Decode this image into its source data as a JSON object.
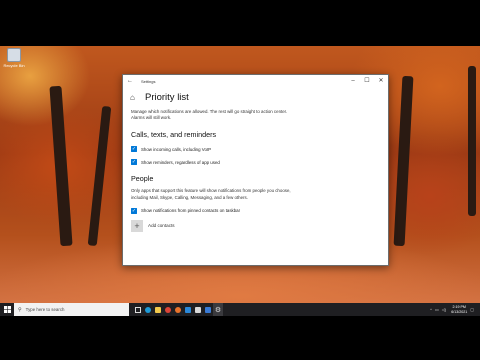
{
  "desktop": {
    "icon_label": "Recycle Bin"
  },
  "window": {
    "app_title": "Settings",
    "page_title": "Priority list",
    "description": "Manage which notifications are allowed. The rest will go straight to action center. Alarms will still work.",
    "sections": {
      "calls": {
        "title": "Calls, texts, and reminders",
        "items": [
          {
            "label": "Show incoming calls, including VoIP",
            "checked": true
          },
          {
            "label": "Show reminders, regardless of app used",
            "checked": true
          }
        ]
      },
      "people": {
        "title": "People",
        "description": "Only apps that support this feature will show notifications from people you choose, including Mail, Skype, Calling, Messaging, and a few others.",
        "items": [
          {
            "label": "Show notifications from pinned contacts on taskbar",
            "checked": true
          }
        ],
        "add_contacts_label": "Add contacts"
      }
    }
  },
  "taskbar": {
    "search_placeholder": "Type here to search",
    "clock_time": "2:19 PM",
    "clock_date": "6/13/2021",
    "pinned_icons": [
      "task-view-icon",
      "edge-icon",
      "file-explorer-icon",
      "chrome-icon",
      "firefox-icon",
      "mail-icon",
      "store-icon",
      "photos-icon",
      "settings-icon"
    ],
    "accent": "#0078d7"
  }
}
